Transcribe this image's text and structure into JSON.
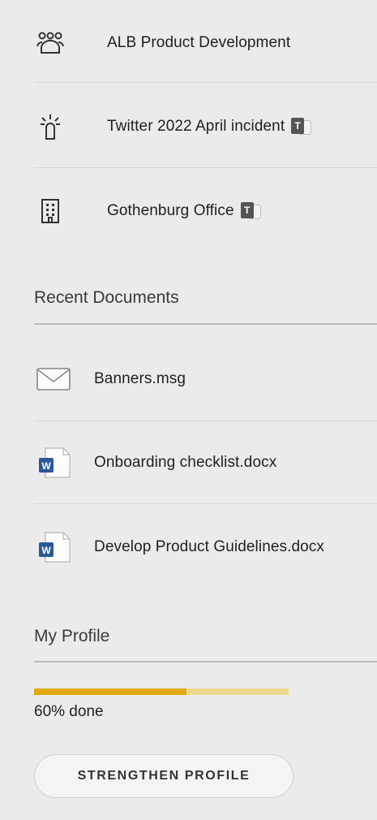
{
  "teams": {
    "items": [
      {
        "label": "ALB Product Development",
        "icon": "people-group-icon",
        "teams_badge": false
      },
      {
        "label": "Twitter 2022 April incident",
        "icon": "incident-beacon-icon",
        "teams_badge": true
      },
      {
        "label": "Gothenburg Office",
        "icon": "building-icon",
        "teams_badge": true
      }
    ],
    "badge_letter": "T"
  },
  "recent_documents": {
    "title": "Recent Documents",
    "items": [
      {
        "label": "Banners.msg",
        "icon": "envelope-icon"
      },
      {
        "label": "Onboarding checklist.docx",
        "icon": "word-document-icon"
      },
      {
        "label": "Develop Product Guidelines.docx",
        "icon": "word-document-icon"
      }
    ],
    "word_badge_letter": "W"
  },
  "profile": {
    "title": "My Profile",
    "progress_percent": 60,
    "progress_text": "60% done",
    "button_label": "STRENGTHEN PROFILE"
  },
  "colors": {
    "background": "#ebebeb",
    "progress_fill": "#e0a812",
    "progress_track": "#ecd78f",
    "word_blue": "#2b579a"
  }
}
